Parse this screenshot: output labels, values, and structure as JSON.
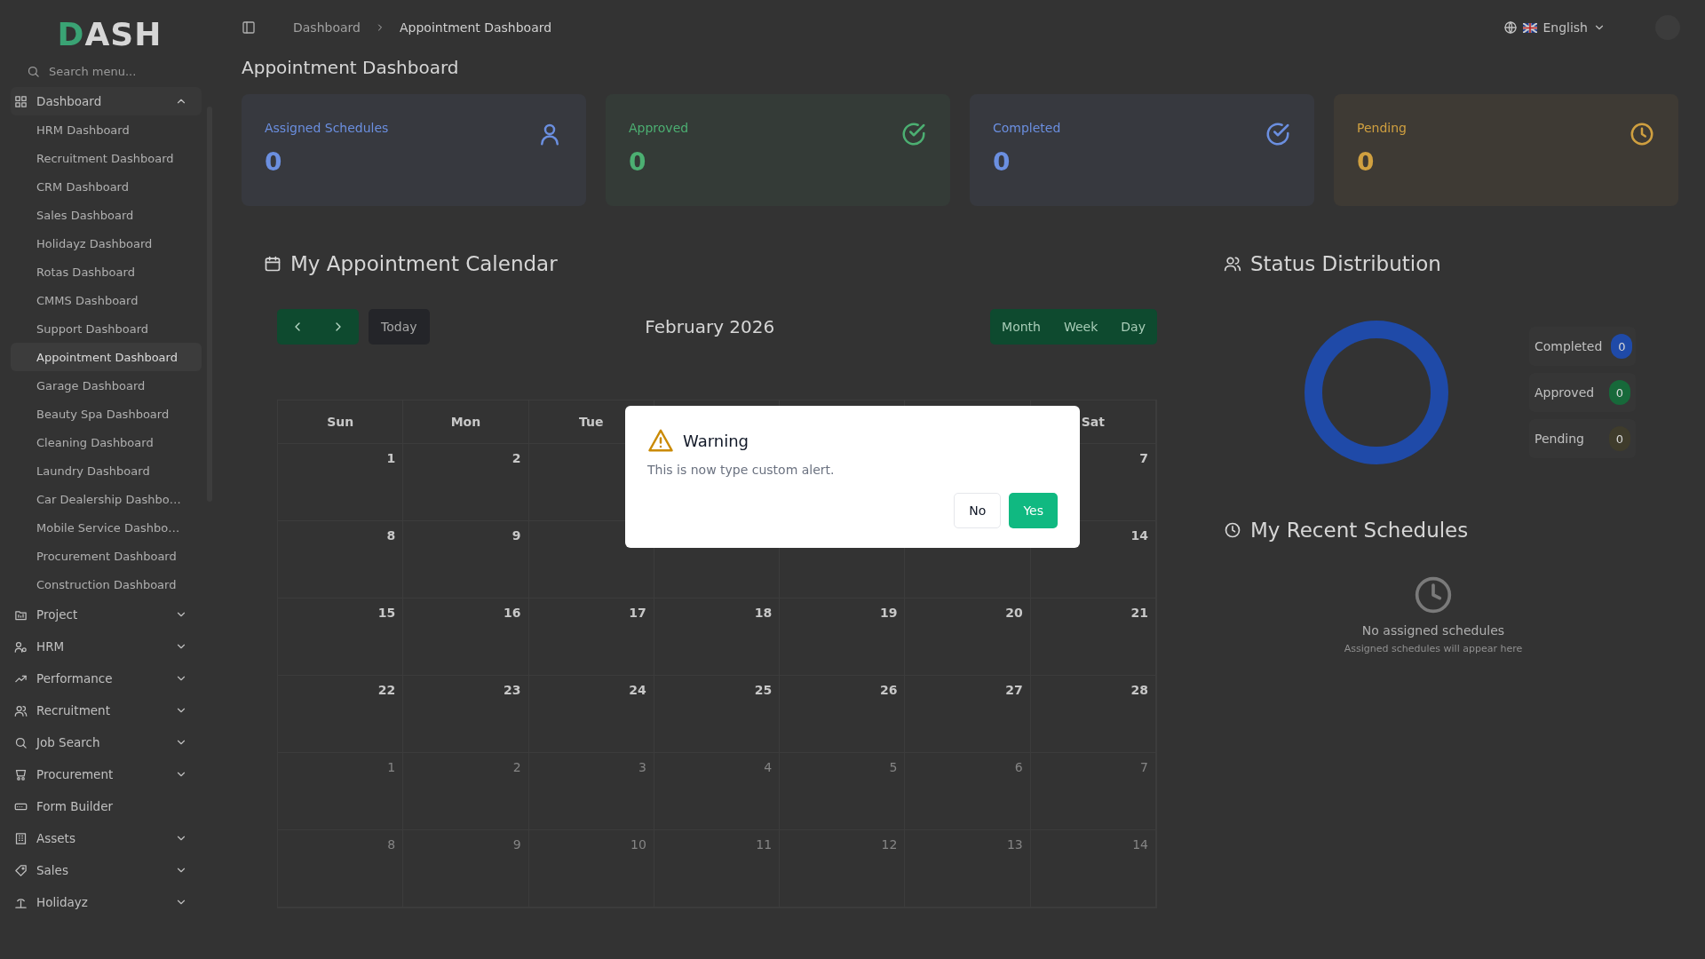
{
  "sidebar": {
    "logo": "DASH",
    "search": {
      "placeholder": "Search menu..."
    },
    "items": [
      {
        "kind": "group",
        "label": "Dashboard",
        "expanded": true,
        "children": [
          {
            "label": "HRM Dashboard",
            "selected": false
          },
          {
            "label": "Recruitment Dashboard",
            "selected": false
          },
          {
            "label": "CRM Dashboard",
            "selected": false
          },
          {
            "label": "Sales Dashboard",
            "selected": false
          },
          {
            "label": "Holidayz Dashboard",
            "selected": false
          },
          {
            "label": "Rotas Dashboard",
            "selected": false
          },
          {
            "label": "CMMS Dashboard",
            "selected": false
          },
          {
            "label": "Support Dashboard",
            "selected": false
          },
          {
            "label": "Appointment Dashboard",
            "selected": true
          },
          {
            "label": "Garage Dashboard",
            "selected": false
          },
          {
            "label": "Beauty Spa Dashboard",
            "selected": false
          },
          {
            "label": "Cleaning Dashboard",
            "selected": false
          },
          {
            "label": "Laundry Dashboard",
            "selected": false
          },
          {
            "label": "Car Dealership Dashbo…",
            "selected": false
          },
          {
            "label": "Mobile Service Dashbo…",
            "selected": false
          },
          {
            "label": "Procurement Dashboard",
            "selected": false
          },
          {
            "label": "Construction Dashboard",
            "selected": false
          }
        ]
      },
      {
        "kind": "group",
        "label": "Project",
        "expanded": false
      },
      {
        "kind": "group",
        "label": "HRM",
        "expanded": false
      },
      {
        "kind": "group",
        "label": "Performance",
        "expanded": false
      },
      {
        "kind": "group",
        "label": "Recruitment",
        "expanded": false
      },
      {
        "kind": "group",
        "label": "Job Search",
        "expanded": false
      },
      {
        "kind": "group",
        "label": "Procurement",
        "expanded": false
      },
      {
        "kind": "link",
        "label": "Form Builder"
      },
      {
        "kind": "group",
        "label": "Assets",
        "expanded": false
      },
      {
        "kind": "group",
        "label": "Sales",
        "expanded": false
      },
      {
        "kind": "group",
        "label": "Holidayz",
        "expanded": false
      }
    ]
  },
  "topbar": {
    "breadcrumb": [
      "Dashboard",
      "Appointment Dashboard"
    ],
    "language": "English"
  },
  "page_title": "Appointment Dashboard",
  "stat_cards": [
    {
      "label": "Assigned Schedules",
      "value": "0",
      "color": "#6b8fe0"
    },
    {
      "label": "Approved",
      "value": "0",
      "color": "#4caf72"
    },
    {
      "label": "Completed",
      "value": "0",
      "color": "#6b8fe0"
    },
    {
      "label": "Pending",
      "value": "0",
      "color": "#d0a040"
    }
  ],
  "calendar": {
    "title": "My Appointment Calendar",
    "today_button": "Today",
    "month": "February 2026",
    "views": [
      "Month",
      "Week",
      "Day"
    ],
    "weekdays": {
      "left": [
        "Sun",
        "Mon",
        "Tue"
      ],
      "right": [
        "Sat"
      ]
    },
    "weeks": [
      {
        "left": [
          {
            "day": "1",
            "muted": false
          },
          {
            "day": "2",
            "muted": false
          }
        ],
        "right": [
          {
            "day": "7",
            "muted": false
          }
        ]
      },
      {
        "left": [
          {
            "day": "8",
            "muted": false
          },
          {
            "day": "9",
            "muted": false
          }
        ],
        "right": [
          {
            "day": "14",
            "muted": false
          }
        ]
      },
      {
        "left": [
          {
            "day": "15",
            "muted": false
          },
          {
            "day": "16",
            "muted": false
          },
          {
            "day": "17",
            "muted": false
          },
          {
            "day": "18",
            "muted": false
          },
          {
            "day": "19",
            "muted": false
          },
          {
            "day": "20",
            "muted": false
          },
          {
            "day": "21",
            "muted": false
          }
        ]
      },
      {
        "left": [
          {
            "day": "22",
            "muted": false
          },
          {
            "day": "23",
            "muted": false
          },
          {
            "day": "24",
            "muted": false
          },
          {
            "day": "25",
            "muted": false
          },
          {
            "day": "26",
            "muted": false
          },
          {
            "day": "27",
            "muted": false
          },
          {
            "day": "28",
            "muted": false
          }
        ]
      },
      {
        "left": [
          {
            "day": "1",
            "muted": true
          },
          {
            "day": "2",
            "muted": true
          },
          {
            "day": "3",
            "muted": true
          },
          {
            "day": "4",
            "muted": true
          },
          {
            "day": "5",
            "muted": true
          },
          {
            "day": "6",
            "muted": true
          },
          {
            "day": "7",
            "muted": true
          }
        ]
      },
      {
        "left": [
          {
            "day": "8",
            "muted": true
          },
          {
            "day": "9",
            "muted": true
          },
          {
            "day": "10",
            "muted": true
          },
          {
            "day": "11",
            "muted": true
          },
          {
            "day": "12",
            "muted": true
          },
          {
            "day": "13",
            "muted": true
          },
          {
            "day": "14",
            "muted": true
          }
        ]
      }
    ]
  },
  "status_distribution": {
    "title": "Status Distribution",
    "legend": [
      {
        "label": "Completed",
        "count": "0",
        "color": "#1f4aa8"
      },
      {
        "label": "Approved",
        "count": "0",
        "color": "#17693a"
      },
      {
        "label": "Pending",
        "count": "0",
        "color": "#3f3c2c"
      }
    ]
  },
  "recent_schedules": {
    "title": "My Recent Schedules",
    "empty_title": "No assigned schedules",
    "empty_text": "Assigned schedules will appear here"
  },
  "dialog": {
    "title": "Warning",
    "message": "This is now type custom alert.",
    "buttons": [
      {
        "label": "No",
        "kind": "secondary"
      },
      {
        "label": "Yes",
        "kind": "primary"
      }
    ]
  }
}
